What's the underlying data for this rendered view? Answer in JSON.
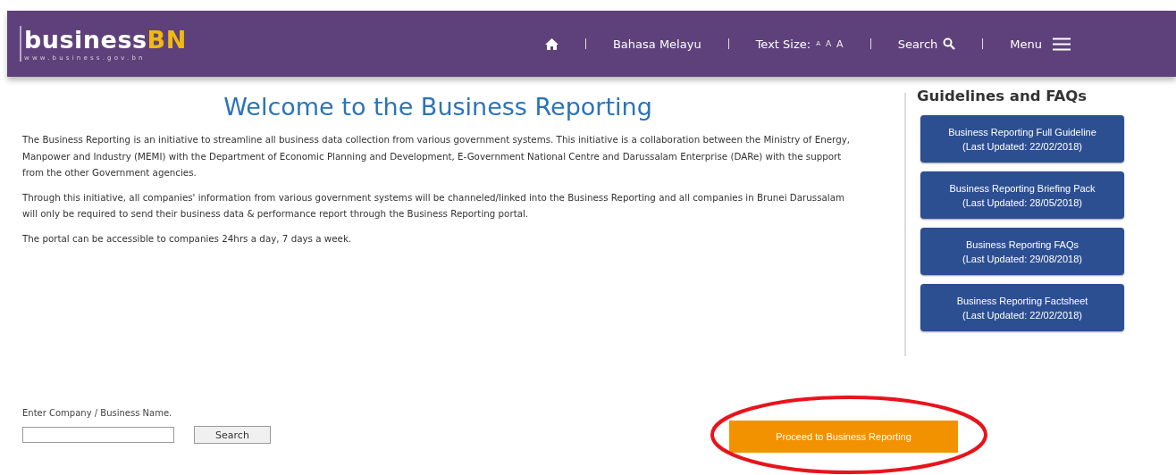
{
  "header": {
    "logo": {
      "text": "business",
      "accent": "BN",
      "url": "www.business.gov.bn"
    },
    "nav": [
      {
        "kind": "home"
      },
      {
        "kind": "link",
        "label": "Bahasa Melayu"
      },
      {
        "kind": "textsize",
        "label": "Text Size:",
        "options": [
          "A",
          "A",
          "A"
        ]
      },
      {
        "kind": "search",
        "label": "Search"
      },
      {
        "kind": "menu",
        "label": "Menu"
      }
    ]
  },
  "main": {
    "title": "Welcome to the Business Reporting",
    "paragraphs": [
      "The Business Reporting is an initiative to streamline all business data collection from various government systems. This initiative is a collaboration between the Ministry of Energy, Manpower and Industry (MEMI) with the Department of Economic Planning and Development, E-Government National Centre and Darussalam Enterprise (DARe) with the support from the other Government agencies.",
      "Through this initiative, all companies' information from various government systems will be channeled/linked into the Business Reporting and all companies in Brunei Darussalam will only be required to send their business data & performance report through the Business Reporting portal.",
      "The portal can be accessible to companies 24hrs a day, 7 days a week."
    ]
  },
  "sidebar": {
    "title": "Guidelines and FAQs",
    "buttons": [
      {
        "label": "Business Reporting Full Guideline",
        "updated": "(Last Updated: 22/02/2018)"
      },
      {
        "label": "Business Reporting Briefing Pack",
        "updated": "(Last Updated: 28/05/2018)"
      },
      {
        "label": "Business Reporting FAQs",
        "updated": "(Last Updated: 29/08/2018)"
      },
      {
        "label": "Business Reporting Factsheet",
        "updated": "(Last Updated: 22/02/2018)"
      }
    ]
  },
  "company_search": {
    "label": "Enter Company / Business Name.",
    "button": "Search"
  },
  "proceed_button": {
    "label": "Proceed to Business Reporting",
    "highlighted": true
  }
}
